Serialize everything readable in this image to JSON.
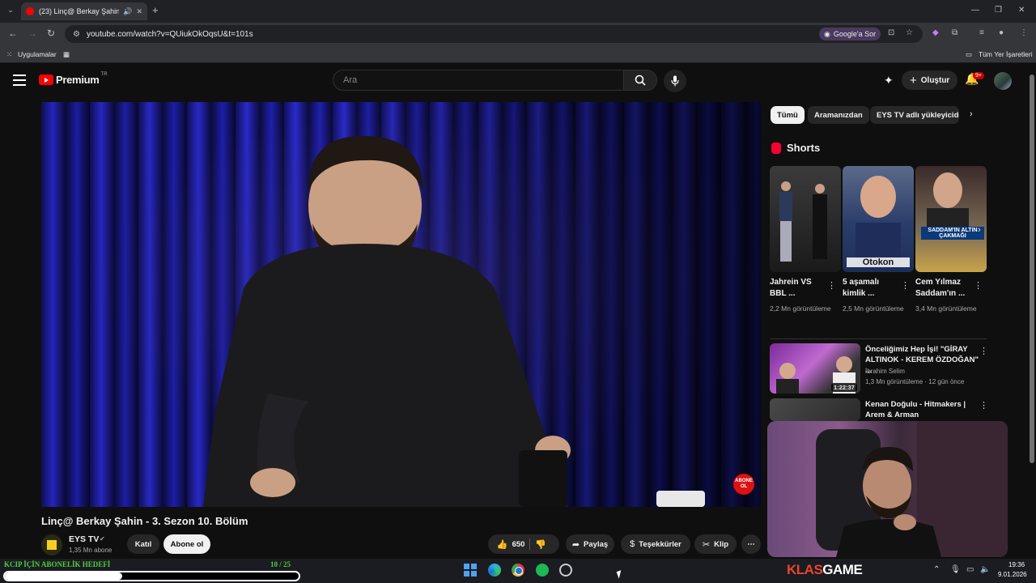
{
  "browser": {
    "tab": {
      "title": "(23) Linç@ Berkay Şahin - 3",
      "audio_icon": "speaker-icon",
      "close": "✕"
    },
    "new_tab": "+",
    "url": "youtube.com/watch?v=QUiukOkOqsU&t=101s",
    "google_ask": "Google'a Sor",
    "bookmarks": {
      "apps": "Uygulamalar",
      "all_bookmarks": "Tüm Yer İşaretleri"
    }
  },
  "youtube": {
    "logo": {
      "wordmark": "Premium",
      "region": "TR"
    },
    "search": {
      "placeholder": "Ara"
    },
    "create_label": "Oluştur",
    "notification_badge": "9+",
    "video": {
      "title": "Linç@ Berkay Şahin - 3. Sezon 10. Bölüm",
      "abone_badge": "ABONE OL",
      "channel": {
        "name": "EYS TV",
        "subscribers": "1,35 Mn abone"
      },
      "join_label": "Katıl",
      "subscribe_label": "Abone ol",
      "likes": "650",
      "share_label": "Paylaş",
      "thanks_label": "Teşekkürler",
      "clip_label": "Klip"
    },
    "chips": [
      "Tümü",
      "Aramanızdan",
      "EYS TV adlı yükleyiciden"
    ],
    "shorts": {
      "heading": "Shorts",
      "items": [
        {
          "title": "Jahrein VS BBL ...",
          "views": "2,2 Mn görüntüleme"
        },
        {
          "title": "5 aşamalı kimlik ...",
          "views": "2,5 Mn görüntüleme",
          "caption": "Otokon"
        },
        {
          "title": "Cem Yılmaz Saddam'ın ...",
          "views": "3,4 Mn görüntüleme",
          "caption": "SADDAM'IN ALTIN ÇAKMAĞI"
        }
      ]
    },
    "recommendations": [
      {
        "title": "Önceliğimiz Hep İşi! \"GİRAY ALTINOK - KEREM ÖZDOĞAN\" ...",
        "channel": "İbrahim Selim",
        "meta": "1,3 Mn görüntüleme · 12 gün önce",
        "duration": "1:22:37"
      },
      {
        "title": "Kenan Doğulu - Hitmakers | Arem & Arman"
      }
    ]
  },
  "stream_overlay": {
    "goal_label": "KCIP İÇİN ABONELİK HEDEFİ",
    "goal_count": "10  /  25",
    "goal_progress": 0.4
  },
  "taskbar": {
    "brand_left": "KLAS",
    "brand_right": "GAME",
    "time": "19:36",
    "date": "9.01.2026"
  },
  "colors": {
    "youtube_red": "#ff0000",
    "goal_green": "#4cd137",
    "background": "#0f0f0f"
  }
}
